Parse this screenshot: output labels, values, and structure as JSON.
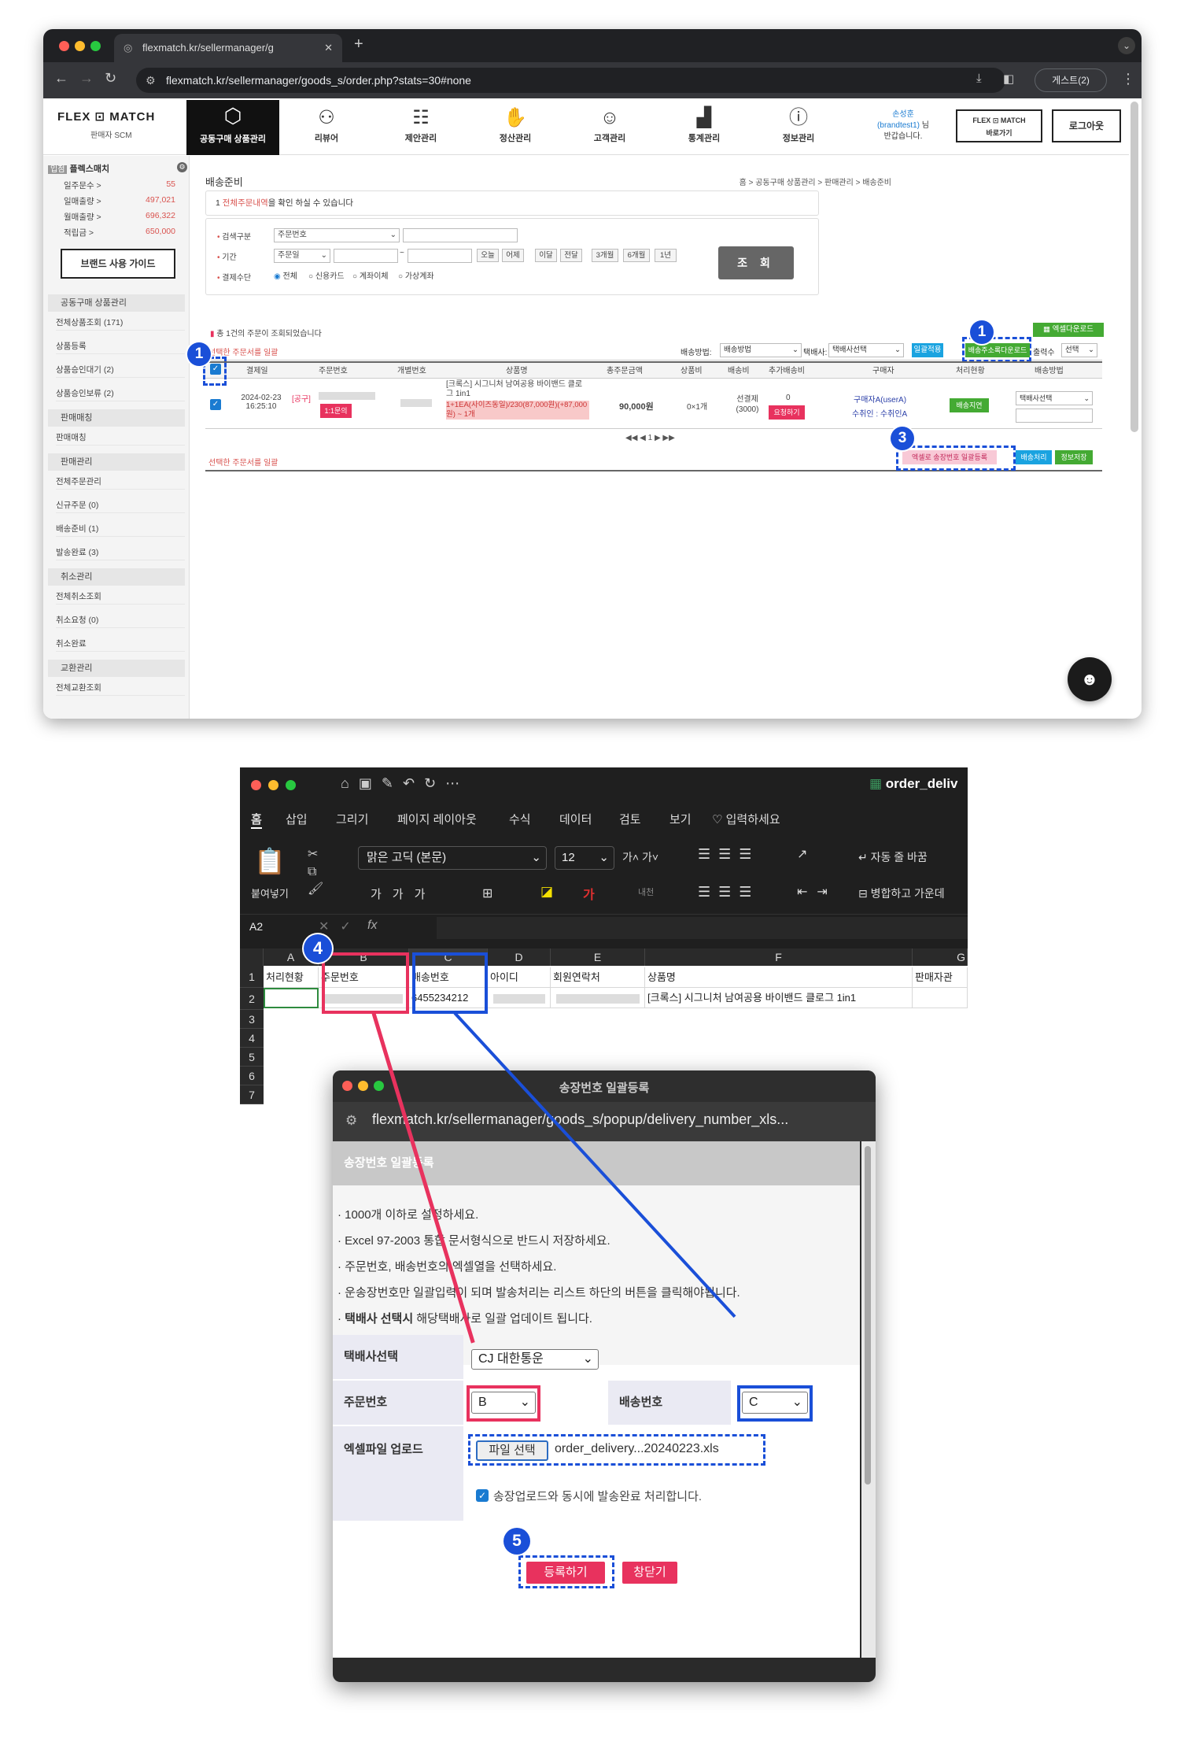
{
  "browser": {
    "tab_title": "flexmatch.kr/sellermanager/g",
    "url": "flexmatch.kr/sellermanager/goods_s/order.php?stats=30#none",
    "guest_label": "게스트(2)"
  },
  "site": {
    "logo": "FLEX ⊡ MATCH",
    "logo_sub": "판매자 SCM",
    "nav": [
      {
        "label": "공동구매 상품관리",
        "icon": "box-icon"
      },
      {
        "label": "리뷰어",
        "icon": "network-icon"
      },
      {
        "label": "제안관리",
        "icon": "group-icon"
      },
      {
        "label": "정산관리",
        "icon": "money-hand-icon"
      },
      {
        "label": "고객관리",
        "icon": "people-icon"
      },
      {
        "label": "통계관리",
        "icon": "chart-icon"
      },
      {
        "label": "정보관리",
        "icon": "info-icon"
      }
    ],
    "user_name": "손성훈",
    "user_id": "(brandtest1)",
    "user_suffix": "님",
    "user_greet": "반갑습니다.",
    "shortcut_logo": "FLEX ⊡ MATCH",
    "shortcut_label": "바로가기",
    "logout_label": "로그아웃"
  },
  "sidebar": {
    "brand_tag": "입점",
    "brand": "플렉스매치",
    "stats": [
      {
        "label": "일주문수",
        "value": "55"
      },
      {
        "label": "일매출량",
        "value": "497,021"
      },
      {
        "label": "월매출량",
        "value": "696,322"
      },
      {
        "label": "적립금",
        "value": "650,000"
      }
    ],
    "guide_button": "브랜드 사용 가이드",
    "sections": [
      {
        "title": "공동구매 상품관리",
        "items": [
          "전체상품조회 (171)",
          "상품등록",
          "상품승인대기 (2)",
          "상품승인보류 (2)"
        ]
      },
      {
        "title": "판매매칭",
        "items": [
          "판매매칭"
        ]
      },
      {
        "title": "판매관리",
        "items": [
          "전체주문관리",
          "신규주문 (0)",
          "배송준비 (1)",
          "발송완료 (3)"
        ]
      },
      {
        "title": "취소관리",
        "items": [
          "전체취소조회",
          "취소요청 (0)",
          "취소완료"
        ]
      },
      {
        "title": "교환관리",
        "items": [
          "전체교환조회"
        ]
      }
    ]
  },
  "content": {
    "page_title": "배송준비",
    "breadcrumb": "홈 > 공동구매 상품관리 > 판매관리 > 배송준비",
    "notice_num": "1",
    "notice_link": "전체주문내역",
    "notice_text": "을 확인 하실 수 있습니다",
    "search": {
      "type_label": "검색구분",
      "type_value": "주문번호",
      "period_label": "기간",
      "period_value": "주문일",
      "tilde": "~",
      "period_buttons": [
        "오늘",
        "어제",
        "이달",
        "전달",
        "3개월",
        "6개월",
        "1년"
      ],
      "pay_label": "결제수단",
      "pay_options": [
        "전체",
        "신용카드",
        "계좌이체",
        "가상계좌"
      ],
      "search_button": "조 회"
    },
    "result_text": "총 1건의 주문이 조회되었습니다",
    "excel_download": "엑셀다운로드",
    "print_selected": "선택한 주문서를 일괄",
    "ship_method_label": "배송방법:",
    "ship_method_value": "배송방법",
    "courier_label": "택배사:",
    "courier_value": "택배사선택",
    "bulk_apply": "일괄적용",
    "address_download": "배송주소록다운로드",
    "output_label": "출력수",
    "output_value": "선택",
    "columns": [
      "결제일",
      "주문번호",
      "개별번호",
      "상품명",
      "총주문금액",
      "상품비",
      "배송비",
      "추가배송비",
      "구매자",
      "처리현황",
      "배송방법"
    ],
    "row": {
      "date": "2024-02-23",
      "time": "16:25:10",
      "order_tag": "[공구]",
      "inquiry": "1:1문의",
      "product": "[크록스] 시그니처 남여공용 바이밴드 클로그 1in1",
      "option": "1+1EA(사이즈동일)/230(87,000원)(+87,000원) ~ 1개",
      "total": "90,000원",
      "product_fee": "0×1개",
      "ship_fee": "선결제(3000)",
      "extra_fee": "0",
      "request": "요청하기",
      "buyer": "구매자A(userA)",
      "receiver": "수취인 : 수취인A",
      "status": "배송지연",
      "courier_select": "택배사선택"
    },
    "pagination": "◀◀ ◀ 1 ▶ ▶▶",
    "bottom_print": "선택한 주문서를 일괄",
    "excel_bulk_register": "엑셀로 송장번호 일괄등록",
    "ship_process": "배송처리",
    "save_info": "정보저장"
  },
  "excel": {
    "filename": "order_deliv",
    "tabs": [
      "홈",
      "삽입",
      "그리기",
      "페이지 레이아웃",
      "수식",
      "데이터",
      "검토",
      "보기"
    ],
    "tell_me": "입력하세요",
    "font_name": "맑은 고딕 (본문)",
    "font_size": "12",
    "paste_label": "붙여넣기",
    "wrap_label": "자동 줄 바꿈",
    "merge_label": "병합하고 가운데",
    "cell_ref": "A2",
    "fx": "fx",
    "columns": [
      "A",
      "B",
      "C",
      "D",
      "E",
      "F",
      "G"
    ],
    "rows": [
      "1",
      "2",
      "3",
      "4",
      "5",
      "6",
      "7"
    ],
    "header_row": [
      "처리현황",
      "주문번호",
      "배송번호",
      "아이디",
      "회원연락처",
      "상품명",
      "판매자관"
    ],
    "data_row": [
      "",
      "",
      "6455234212",
      "",
      "",
      "[크록스] 시그니처 남여공용 바이밴드 클로그 1in1",
      ""
    ]
  },
  "popup": {
    "title": "송장번호 일괄등록",
    "url": "flexmatch.kr/sellermanager/goods_s/popup/delivery_number_xls...",
    "heading": "송장번호 일괄등록",
    "instructions": [
      "1000개 이하로 설정하세요.",
      "Excel 97-2003 통합 문서형식으로 반드시 저장하세요.",
      "주문번호, 배송번호의 엑셀열을 선택하세요.",
      "운송장번호만 일괄입력이 되며 발송처리는 리스트 하단의 버튼을 클릭해야됩니다."
    ],
    "instruction_bold": "택배사 선택시",
    "instruction_last": " 해당택배사로 일괄 업데이트 됩니다.",
    "courier_label": "택배사선택",
    "courier_value": "CJ 대한통운",
    "order_label": "주문번호",
    "order_value": "B",
    "ship_label": "배송번호",
    "ship_value": "C",
    "upload_label": "엑셀파일 업로드",
    "file_button": "파일 선택",
    "file_name": "order_delivery...20240223.xls",
    "checkbox_label": "송장업로드와 동시에 발송완료 처리합니다.",
    "register_button": "등록하기",
    "close_button": "창닫기"
  },
  "steps": [
    "1",
    "1",
    "3",
    "4",
    "5"
  ],
  "colors": {
    "accent_blue": "#1a4fd8",
    "accent_red": "#e8325e",
    "green": "#44aa33"
  }
}
